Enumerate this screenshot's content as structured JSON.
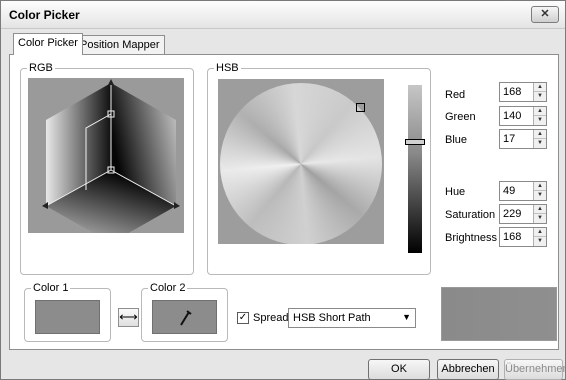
{
  "window": {
    "title": "Color Picker",
    "close_label": "✕"
  },
  "tabs": [
    {
      "label": "Color Picker",
      "active": true
    },
    {
      "label": "Position Mapper",
      "active": false
    }
  ],
  "rgb_group": {
    "label": "RGB"
  },
  "hsb_group": {
    "label": "HSB"
  },
  "rgb_fields": [
    {
      "label": "Red",
      "value": "168"
    },
    {
      "label": "Green",
      "value": "140"
    },
    {
      "label": "Blue",
      "value": "17"
    }
  ],
  "hsb_fields": [
    {
      "label": "Hue",
      "value": "49"
    },
    {
      "label": "Saturation",
      "value": "229"
    },
    {
      "label": "Brightness",
      "value": "168"
    }
  ],
  "color1": {
    "label": "Color 1",
    "color": "#8c8c8c"
  },
  "color2": {
    "label": "Color 2",
    "color": "#8c8c8c"
  },
  "swap_icon": "⟷",
  "spread": {
    "label": "Spread",
    "checked": true
  },
  "gradient_mode": {
    "value": "HSB Short Path"
  },
  "buttons": {
    "ok": "OK",
    "cancel": "Abbrechen",
    "apply": "Übernehmen"
  }
}
